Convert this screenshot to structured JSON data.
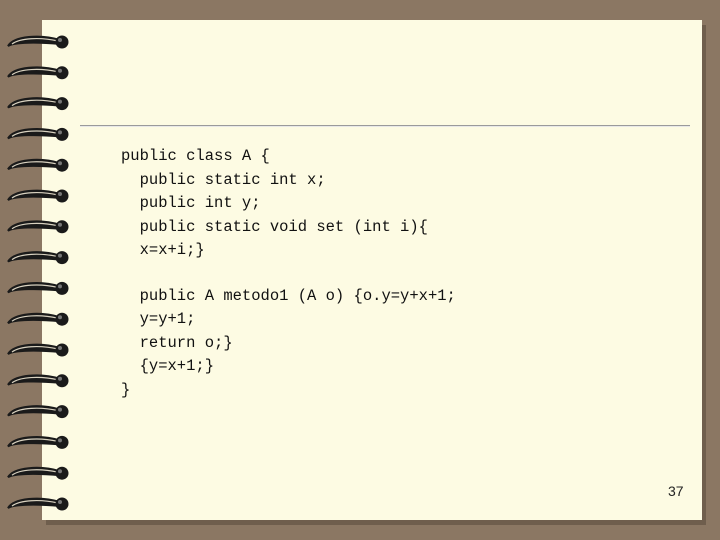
{
  "slide": {
    "code_lines_top": [
      "public class A {",
      "  public static int x;",
      "  public int y;",
      "  public static void set (int i){",
      "  x=x+i;}"
    ],
    "code_lines_bottom": [
      "  public A metodo1 (A o) {o.y=y+x+1;",
      "  y=y+1;",
      "  return o;}",
      "  {y=x+1;}",
      "}"
    ],
    "page_number": "37"
  },
  "colors": {
    "background": "#8b7763",
    "paper": "#fdfbe3",
    "ring": "#1a1a1a"
  }
}
